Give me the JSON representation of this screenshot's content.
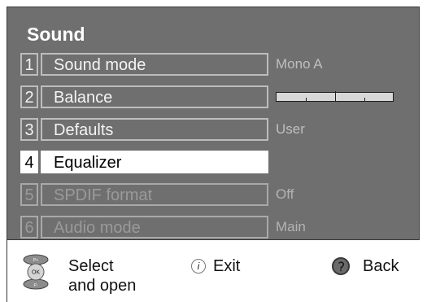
{
  "menu": {
    "title": "Sound",
    "items": [
      {
        "num": "1",
        "label": "Sound mode",
        "value": "Mono A"
      },
      {
        "num": "2",
        "label": "Balance",
        "value": ""
      },
      {
        "num": "3",
        "label": "Defaults",
        "value": "User"
      },
      {
        "num": "4",
        "label": "Equalizer",
        "value": ""
      },
      {
        "num": "5",
        "label": "SPDIF format",
        "value": "Off"
      },
      {
        "num": "6",
        "label": "Audio mode",
        "value": "Main"
      }
    ],
    "balance_level": 0.5
  },
  "footer": {
    "select_line1": "Select",
    "select_line2": "and open",
    "exit_label": "Exit",
    "back_label": "Back",
    "info_glyph": "i",
    "pad_up": "P+",
    "pad_ok": "OK",
    "pad_down": "P-"
  },
  "colors": {
    "panel": "#6f6f6f",
    "selected_bg": "#ffffff",
    "disabled_text": "#9a9a9a"
  },
  "icons": [
    "dpad-ok-icon",
    "info-icon",
    "back-icon"
  ]
}
